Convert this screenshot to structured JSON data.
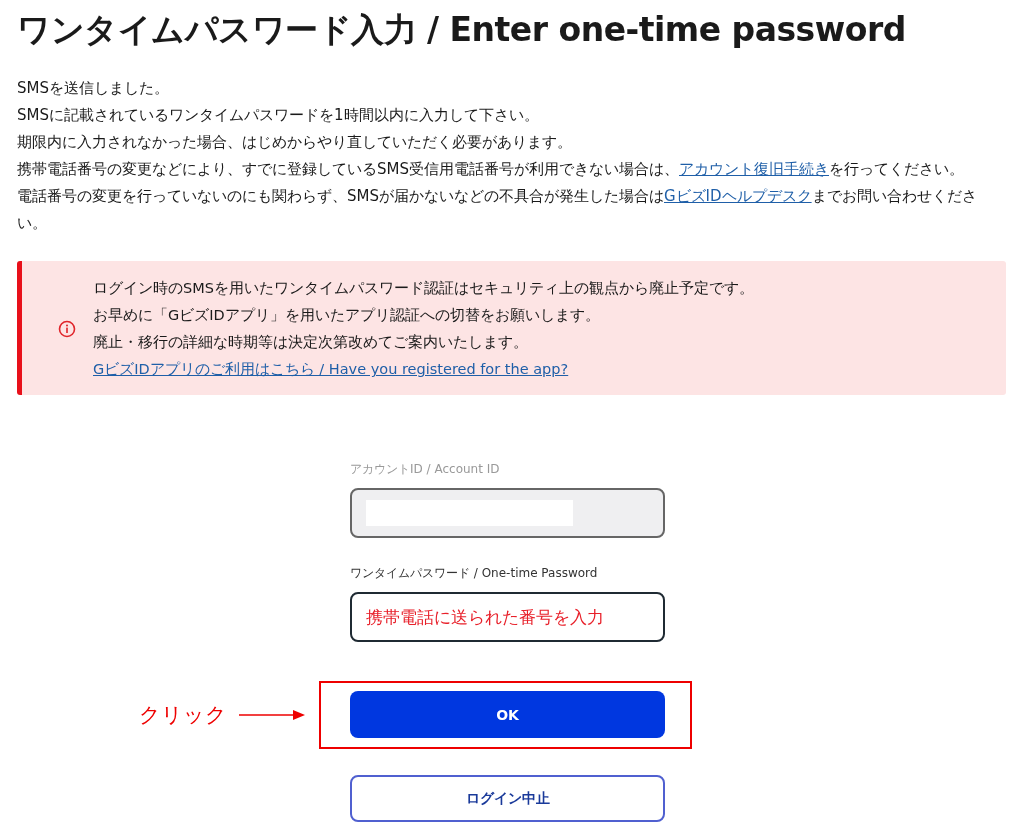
{
  "title": "ワンタイムパスワード入力 / Enter one-time password",
  "intro": [
    {
      "text": "SMSを送信しました。"
    },
    {
      "text": "SMSに記載されているワンタイムパスワードを1時間以内に入力して下さい。"
    },
    {
      "text": "期限内に入力されなかった場合、はじめからやり直していただく必要があります。"
    },
    {
      "text": "携帯電話番号の変更などにより、すでに登録しているSMS受信用電話番号が利用できない場合は、",
      "link": "アカウント復旧手続き",
      "after": "を行ってください。"
    },
    {
      "text": "電話番号の変更を行っていないのにも関わらず、SMSが届かないなどの不具合が発生した場合は",
      "link": "GビズIDヘルプデスク",
      "after": "までお問い合わせください。"
    }
  ],
  "alert": {
    "lines": [
      "ログイン時のSMSを用いたワンタイムパスワード認証はセキュリティ上の観点から廃止予定です。",
      "お早めに「GビズIDアプリ」を用いたアプリ認証への切替をお願いします。",
      "廃止・移行の詳細な時期等は決定次第改めてご案内いたします。"
    ],
    "link": "GビズIDアプリのご利用はこちら / Have you registered for the app?"
  },
  "fields": [
    {
      "label": "アカウントID / Account ID",
      "disabled": true,
      "redacted": true
    },
    {
      "label": "ワンタイムパスワード / One-time Password",
      "disabled": false,
      "value": "携帯電話に送られた番号を入力"
    }
  ],
  "buttons": [
    {
      "label": "OK",
      "kind": "primary",
      "highlighted": true
    },
    {
      "label": "ログイン中止",
      "kind": "secondary",
      "highlighted": false
    }
  ],
  "callout": "クリック"
}
